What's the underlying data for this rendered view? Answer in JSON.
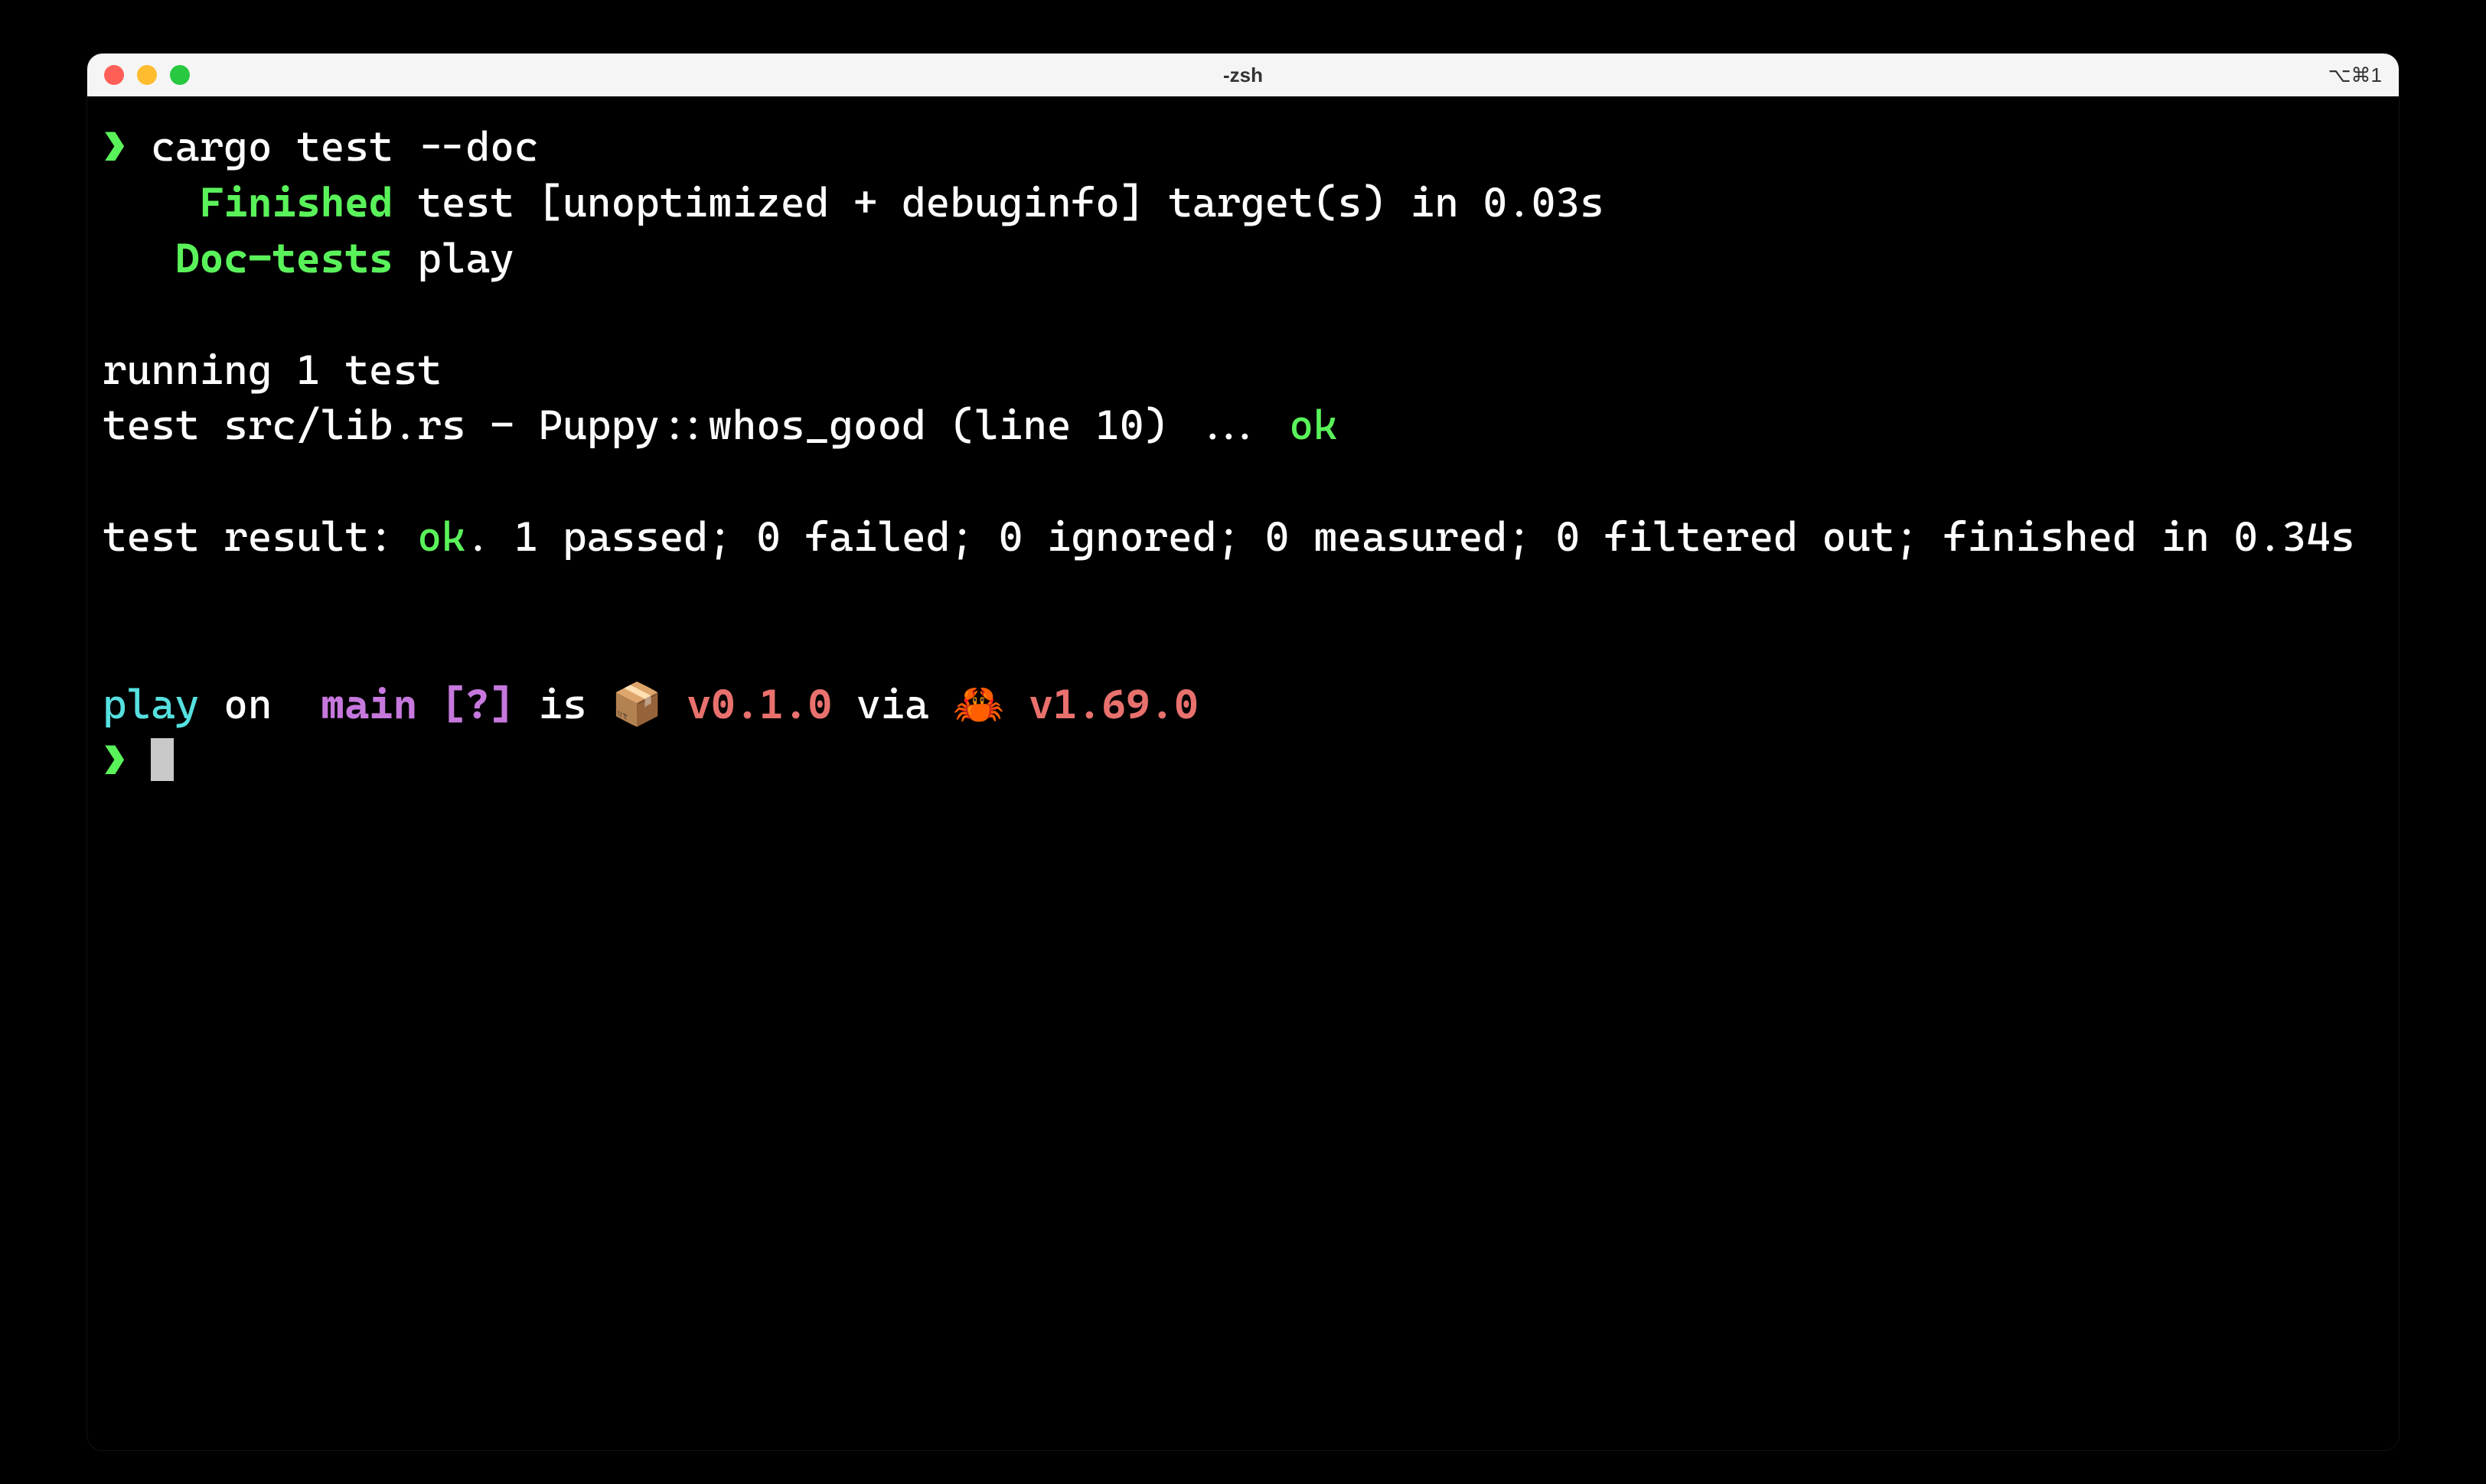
{
  "window": {
    "title": "-zsh",
    "shortcut": "⌥⌘1"
  },
  "terminal": {
    "prompt1_arrow": "❯",
    "command": "cargo test --doc",
    "line_finished_label": "Finished",
    "line_finished_rest": " test [unoptimized + debuginfo] target(s) in 0.03s",
    "line_doctests_label": "Doc-tests",
    "line_doctests_rest": " play",
    "running_line": "running 1 test",
    "test_line_prefix": "test src/lib.rs - Puppy::whos_good (line 10) ... ",
    "test_line_status": "ok",
    "result_prefix": "test result: ",
    "result_status": "ok",
    "result_suffix": ". 1 passed; 0 failed; 0 ignored; 0 measured; 0 filtered out; finished in 0.34s",
    "status_dir": "play",
    "status_on": " on ",
    "status_branch_icon": " ",
    "status_branch": "main",
    "status_branch_flags": " [?]",
    "status_is": " is ",
    "status_pkg_icon": "📦 ",
    "status_pkg_version": "v0.1.0",
    "status_via": " via ",
    "status_rust_icon": "🦀 ",
    "status_rust_version": "v1.69.0",
    "prompt2_arrow": "❯"
  }
}
